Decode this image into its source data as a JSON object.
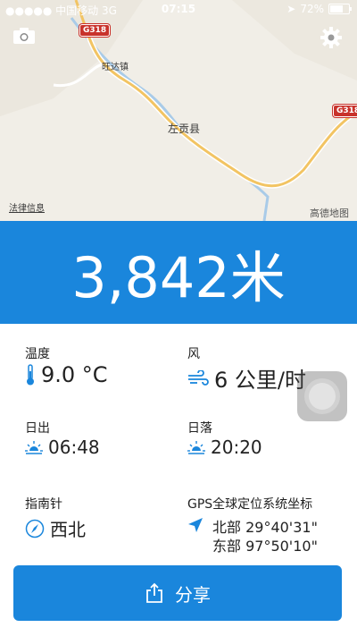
{
  "status_bar": {
    "carrier": "●●●●● 中国移动  3G",
    "time": "07:15",
    "battery_percent": "72%",
    "battery_level": 0.72
  },
  "map": {
    "road_badge_1": "G318",
    "road_badge_2": "G318",
    "town": "旺达镇",
    "county": "左贡县",
    "legal_link": "法律信息",
    "attribution": "高德地图"
  },
  "altitude": "3,842米",
  "temperature": {
    "label": "温度",
    "value": "9.0 °C"
  },
  "wind": {
    "label": "风",
    "value": "6 公里/时"
  },
  "sunrise": {
    "label": "日出",
    "value": "06:48"
  },
  "sunset": {
    "label": "日落",
    "value": "20:20"
  },
  "compass": {
    "label": "指南针",
    "value": "西北"
  },
  "gps": {
    "label": "GPS全球定位系统坐标",
    "north": "北部 29°40'31\"",
    "east": "东部 97°50'10\""
  },
  "share_button": {
    "label": "分享"
  },
  "colors": {
    "accent": "#1a86dc",
    "road_badge": "#c8322b"
  }
}
